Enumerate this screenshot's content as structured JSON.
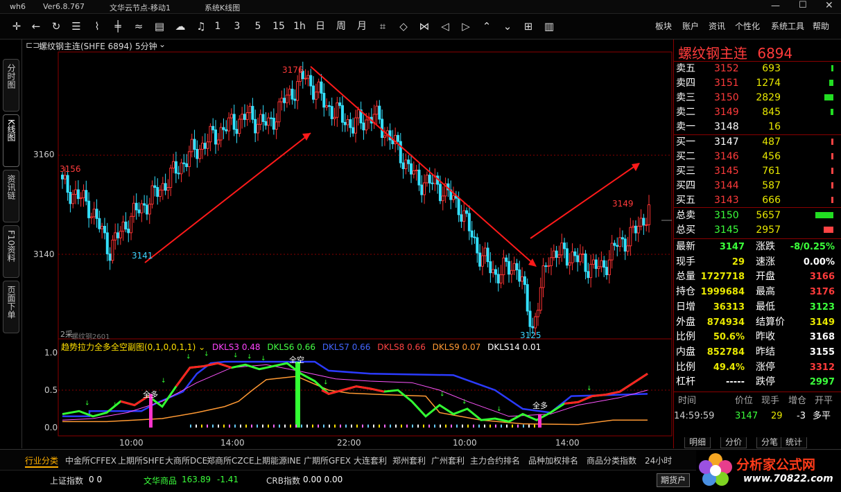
{
  "window": {
    "app_name": "wh6",
    "version": "Ver6.8.767",
    "title": "文华云节点-移动1",
    "section": "系统K线图"
  },
  "toolbar": {
    "periods": [
      "1",
      "3",
      "5",
      "15",
      "1h",
      "日",
      "周",
      "月"
    ],
    "menus": [
      "板块",
      "账户",
      "资讯",
      "个性化",
      "系统工具",
      "帮助"
    ]
  },
  "left_tabs": [
    "分时图",
    "K线图",
    "资讯链",
    "F10资料",
    "页面下单"
  ],
  "chart_header": {
    "contract": "螺纹钢主连(SHFE 6894)",
    "period": "5分钟"
  },
  "main_chart": {
    "y_labels": [
      "3160",
      "3140"
    ],
    "price_marks": [
      "3176",
      "3156",
      "3141",
      "3125",
      "3149"
    ],
    "contract_note": "2采",
    "contract_label": "螺纹钢2601"
  },
  "indicator": {
    "name": "趋势拉力全多全空副图(0,1,0,0,1,1)",
    "params": [
      {
        "name": "DKLS3",
        "value": "0.48",
        "color": "#ff44ff"
      },
      {
        "name": "DKLS6",
        "value": "0.66",
        "color": "#44ff44"
      },
      {
        "name": "DKLS7",
        "value": "0.66",
        "color": "#4466ff"
      },
      {
        "name": "DKLS8",
        "value": "0.66",
        "color": "#ff4444"
      },
      {
        "name": "DKLS9",
        "value": "0.07",
        "color": "#ff9933"
      },
      {
        "name": "DKLS14",
        "value": "0.01",
        "color": "#ffffff"
      }
    ],
    "y_labels": [
      "1.0",
      "0.5",
      "0.0"
    ],
    "signals": [
      "全多",
      "全空",
      "全多"
    ]
  },
  "time_axis": [
    "10:00",
    "14:00",
    "22:00",
    "10:00",
    "14:00"
  ],
  "quote": {
    "title": "螺纹钢主连",
    "code": "6894",
    "asks": [
      {
        "label": "卖五",
        "price": "3152",
        "vol": "693",
        "bar": 0.12
      },
      {
        "label": "卖四",
        "price": "3151",
        "vol": "1274",
        "bar": 0.22
      },
      {
        "label": "卖三",
        "price": "3150",
        "vol": "2829",
        "bar": 0.5
      },
      {
        "label": "卖二",
        "price": "3149",
        "vol": "845",
        "bar": 0.15
      },
      {
        "label": "卖一",
        "price": "3148",
        "vol": "16",
        "bar": 0.0
      }
    ],
    "bids": [
      {
        "label": "买一",
        "price": "3147",
        "vol": "487",
        "bar": 0.08
      },
      {
        "label": "买二",
        "price": "3146",
        "vol": "456",
        "bar": 0.08
      },
      {
        "label": "买三",
        "price": "3145",
        "vol": "761",
        "bar": 0.13
      },
      {
        "label": "买四",
        "price": "3144",
        "vol": "587",
        "bar": 0.1
      },
      {
        "label": "买五",
        "price": "3143",
        "vol": "666",
        "bar": 0.11
      }
    ],
    "totals": [
      {
        "label": "总卖",
        "price": "3150",
        "vol": "5657",
        "bar": 1.0
      },
      {
        "label": "总买",
        "price": "3145",
        "vol": "2957",
        "bar": 0.52
      }
    ],
    "stats": [
      {
        "l1": "最新",
        "v1": "3147",
        "c1": "green",
        "l2": "涨跌",
        "v2": "-8/0.25%",
        "c2": "green"
      },
      {
        "l1": "现手",
        "v1": "29",
        "c1": "yellow",
        "l2": "速涨",
        "v2": "0.00%",
        "c2": "white"
      },
      {
        "l1": "总量",
        "v1": "1727718",
        "c1": "yellow",
        "l2": "开盘",
        "v2": "3166",
        "c2": "red"
      },
      {
        "l1": "持仓",
        "v1": "1999684",
        "c1": "yellow",
        "l2": "最高",
        "v2": "3176",
        "c2": "red"
      },
      {
        "l1": "日增",
        "v1": "36313",
        "c1": "yellow",
        "l2": "最低",
        "v2": "3123",
        "c2": "green"
      },
      {
        "l1": "外盘",
        "v1": "874934",
        "c1": "yellow",
        "l2": "结算价",
        "v2": "3149",
        "c2": "yellow"
      },
      {
        "l1": "比例",
        "v1": "50.6%",
        "c1": "yellow",
        "l2": "昨收",
        "v2": "3168",
        "c2": "white"
      },
      {
        "l1": "内盘",
        "v1": "852784",
        "c1": "yellow",
        "l2": "昨结",
        "v2": "3155",
        "c2": "white"
      },
      {
        "l1": "比例",
        "v1": "49.4%",
        "c1": "yellow",
        "l2": "涨停",
        "v2": "3312",
        "c2": "red"
      },
      {
        "l1": "杠杆",
        "v1": "-----",
        "c1": "white",
        "l2": "跌停",
        "v2": "2997",
        "c2": "green"
      }
    ],
    "tick_header": [
      "时间",
      "价位",
      "现手",
      "增仓",
      "开平"
    ],
    "tick": {
      "time": "14:59:59",
      "price": "3147",
      "vol": "29",
      "oi": "-3",
      "type": "多平"
    },
    "bottom_tabs": [
      "明细",
      "分价",
      "分笔",
      "统计"
    ]
  },
  "bottom_tabs": [
    "行业分类",
    "中金所CFFEX",
    "上期所SHFE",
    "大商所DCE",
    "郑商所CZCE",
    "上期能源INE",
    "广期所GFEX",
    "大连套利",
    "郑州套利",
    "广州套利",
    "主力合约排名",
    "品种加权排名",
    "商品分类指数",
    "24小时"
  ],
  "status": {
    "sh_label": "上证指数",
    "sh_val": "0  0",
    "wh_label": "文华商品",
    "wh_val": "163.89",
    "wh_chg": "-1.41",
    "crb_label": "CRB指数",
    "crb_val": "0.00  0.00",
    "account_button": "期货户"
  },
  "logo": {
    "text": "分析家公式网",
    "url": "www.70822.com"
  },
  "watermark": "www.70822.com 分析家公式网"
}
